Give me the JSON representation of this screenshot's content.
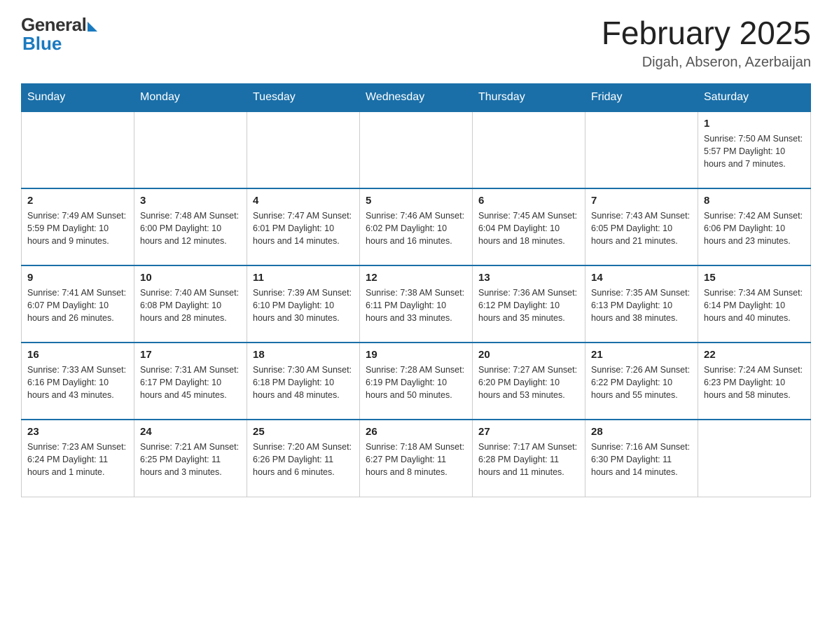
{
  "header": {
    "logo_general": "General",
    "logo_blue": "Blue",
    "month_title": "February 2025",
    "location": "Digah, Abseron, Azerbaijan"
  },
  "weekdays": [
    "Sunday",
    "Monday",
    "Tuesday",
    "Wednesday",
    "Thursday",
    "Friday",
    "Saturday"
  ],
  "weeks": [
    [
      {
        "day": "",
        "info": ""
      },
      {
        "day": "",
        "info": ""
      },
      {
        "day": "",
        "info": ""
      },
      {
        "day": "",
        "info": ""
      },
      {
        "day": "",
        "info": ""
      },
      {
        "day": "",
        "info": ""
      },
      {
        "day": "1",
        "info": "Sunrise: 7:50 AM\nSunset: 5:57 PM\nDaylight: 10 hours and 7 minutes."
      }
    ],
    [
      {
        "day": "2",
        "info": "Sunrise: 7:49 AM\nSunset: 5:59 PM\nDaylight: 10 hours and 9 minutes."
      },
      {
        "day": "3",
        "info": "Sunrise: 7:48 AM\nSunset: 6:00 PM\nDaylight: 10 hours and 12 minutes."
      },
      {
        "day": "4",
        "info": "Sunrise: 7:47 AM\nSunset: 6:01 PM\nDaylight: 10 hours and 14 minutes."
      },
      {
        "day": "5",
        "info": "Sunrise: 7:46 AM\nSunset: 6:02 PM\nDaylight: 10 hours and 16 minutes."
      },
      {
        "day": "6",
        "info": "Sunrise: 7:45 AM\nSunset: 6:04 PM\nDaylight: 10 hours and 18 minutes."
      },
      {
        "day": "7",
        "info": "Sunrise: 7:43 AM\nSunset: 6:05 PM\nDaylight: 10 hours and 21 minutes."
      },
      {
        "day": "8",
        "info": "Sunrise: 7:42 AM\nSunset: 6:06 PM\nDaylight: 10 hours and 23 minutes."
      }
    ],
    [
      {
        "day": "9",
        "info": "Sunrise: 7:41 AM\nSunset: 6:07 PM\nDaylight: 10 hours and 26 minutes."
      },
      {
        "day": "10",
        "info": "Sunrise: 7:40 AM\nSunset: 6:08 PM\nDaylight: 10 hours and 28 minutes."
      },
      {
        "day": "11",
        "info": "Sunrise: 7:39 AM\nSunset: 6:10 PM\nDaylight: 10 hours and 30 minutes."
      },
      {
        "day": "12",
        "info": "Sunrise: 7:38 AM\nSunset: 6:11 PM\nDaylight: 10 hours and 33 minutes."
      },
      {
        "day": "13",
        "info": "Sunrise: 7:36 AM\nSunset: 6:12 PM\nDaylight: 10 hours and 35 minutes."
      },
      {
        "day": "14",
        "info": "Sunrise: 7:35 AM\nSunset: 6:13 PM\nDaylight: 10 hours and 38 minutes."
      },
      {
        "day": "15",
        "info": "Sunrise: 7:34 AM\nSunset: 6:14 PM\nDaylight: 10 hours and 40 minutes."
      }
    ],
    [
      {
        "day": "16",
        "info": "Sunrise: 7:33 AM\nSunset: 6:16 PM\nDaylight: 10 hours and 43 minutes."
      },
      {
        "day": "17",
        "info": "Sunrise: 7:31 AM\nSunset: 6:17 PM\nDaylight: 10 hours and 45 minutes."
      },
      {
        "day": "18",
        "info": "Sunrise: 7:30 AM\nSunset: 6:18 PM\nDaylight: 10 hours and 48 minutes."
      },
      {
        "day": "19",
        "info": "Sunrise: 7:28 AM\nSunset: 6:19 PM\nDaylight: 10 hours and 50 minutes."
      },
      {
        "day": "20",
        "info": "Sunrise: 7:27 AM\nSunset: 6:20 PM\nDaylight: 10 hours and 53 minutes."
      },
      {
        "day": "21",
        "info": "Sunrise: 7:26 AM\nSunset: 6:22 PM\nDaylight: 10 hours and 55 minutes."
      },
      {
        "day": "22",
        "info": "Sunrise: 7:24 AM\nSunset: 6:23 PM\nDaylight: 10 hours and 58 minutes."
      }
    ],
    [
      {
        "day": "23",
        "info": "Sunrise: 7:23 AM\nSunset: 6:24 PM\nDaylight: 11 hours and 1 minute."
      },
      {
        "day": "24",
        "info": "Sunrise: 7:21 AM\nSunset: 6:25 PM\nDaylight: 11 hours and 3 minutes."
      },
      {
        "day": "25",
        "info": "Sunrise: 7:20 AM\nSunset: 6:26 PM\nDaylight: 11 hours and 6 minutes."
      },
      {
        "day": "26",
        "info": "Sunrise: 7:18 AM\nSunset: 6:27 PM\nDaylight: 11 hours and 8 minutes."
      },
      {
        "day": "27",
        "info": "Sunrise: 7:17 AM\nSunset: 6:28 PM\nDaylight: 11 hours and 11 minutes."
      },
      {
        "day": "28",
        "info": "Sunrise: 7:16 AM\nSunset: 6:30 PM\nDaylight: 11 hours and 14 minutes."
      },
      {
        "day": "",
        "info": ""
      }
    ]
  ]
}
